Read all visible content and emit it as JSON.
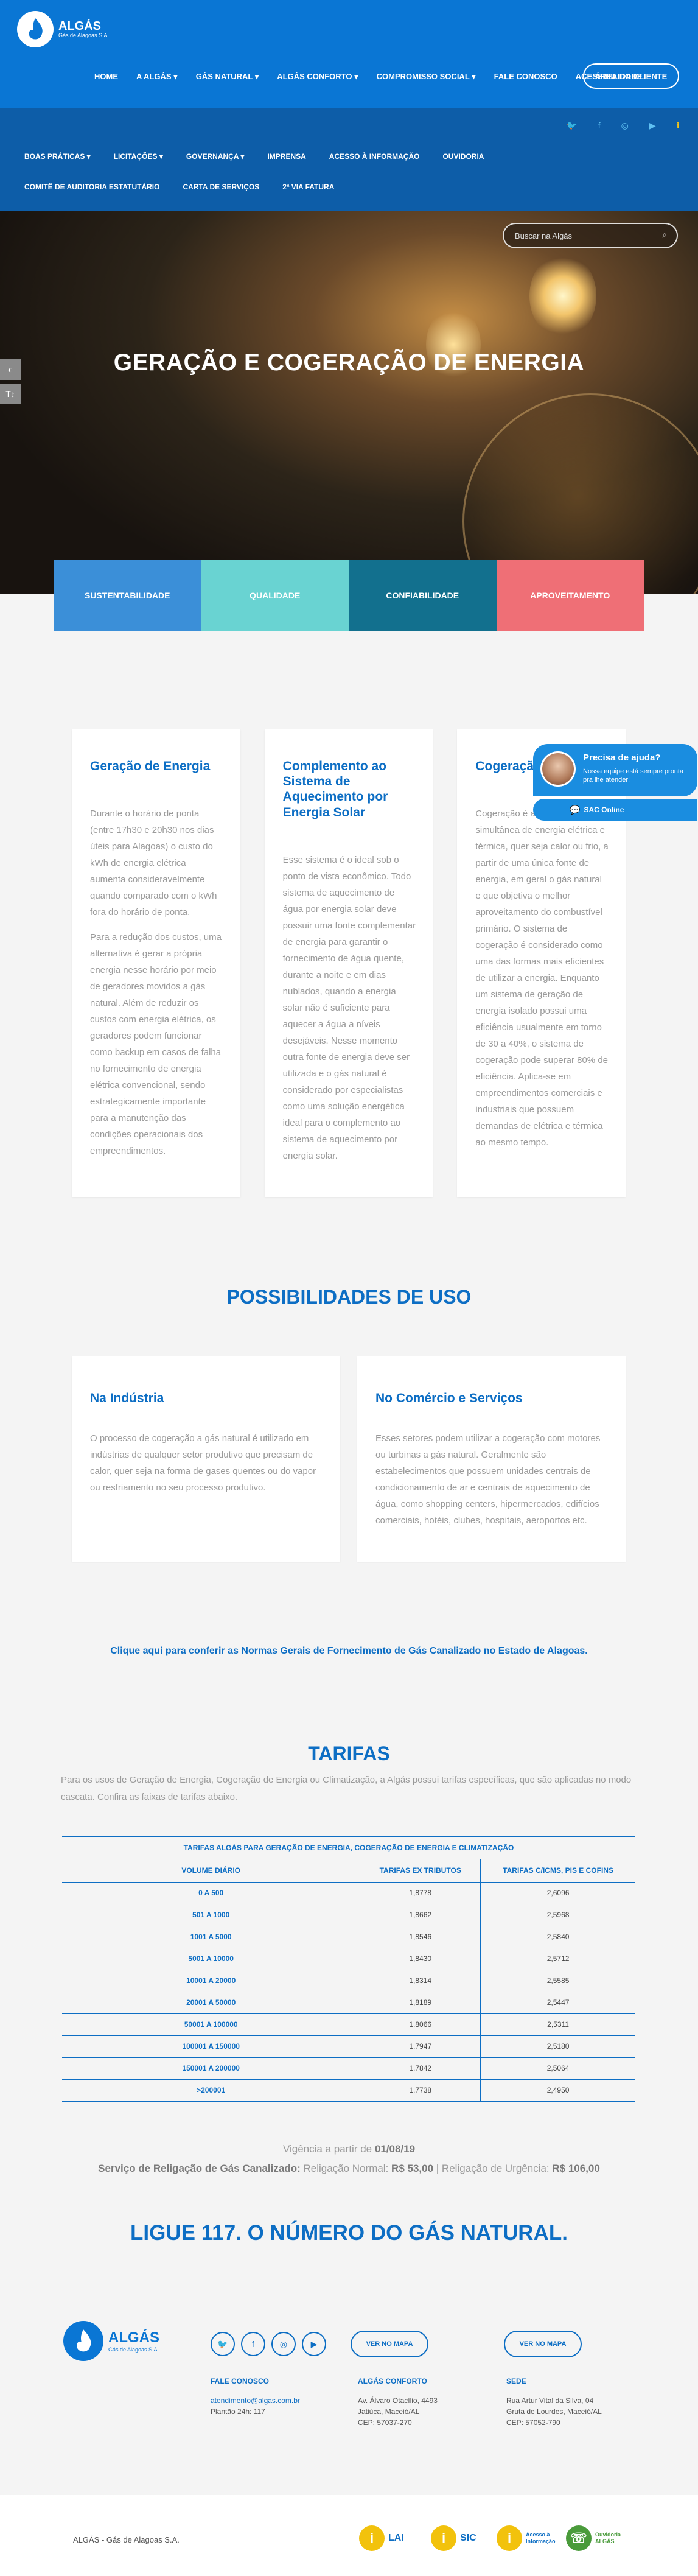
{
  "brand": {
    "name": "ALGÁS",
    "subtitle": "Gás de Alagoas S.A."
  },
  "main_nav": [
    "HOME",
    "A ALGÁS ▾",
    "GÁS NATURAL ▾",
    "ALGÁS CONFORTO ▾",
    "COMPROMISSO SOCIAL ▾",
    "FALE CONOSCO",
    "ACESSIBILIDADE"
  ],
  "client_area": "ÁREA DO CLIENTE",
  "sub_nav": [
    "BOAS PRÁTICAS ▾",
    "LICITAÇÕES ▾",
    "GOVERNANÇA ▾",
    "IMPRENSA",
    "ACESSO À INFORMAÇÃO",
    "OUVIDORIA",
    "COMITÊ DE AUDITORIA ESTATUTÁRIO",
    "CARTA DE SERVIÇOS",
    "2ª VIA FATURA"
  ],
  "search": {
    "placeholder": "Buscar na Algás"
  },
  "hero": {
    "title": "GERAÇÃO E COGERAÇÃO DE ENERGIA"
  },
  "pillars": [
    {
      "label": "SUSTENTABILIDADE",
      "color": "#3b8fd8"
    },
    {
      "label": "QUALIDADE",
      "color": "#69d3d2"
    },
    {
      "label": "CONFIABILIDADE",
      "color": "#12708e"
    },
    {
      "label": "APROVEITAMENTO",
      "color": "#ef6f76"
    }
  ],
  "cards": [
    {
      "title": "Geração de Energia",
      "paragraphs": [
        "Durante o horário de ponta (entre 17h30 e 20h30 nos dias úteis para Alagoas) o custo do kWh de energia elétrica aumenta consideravelmente quando comparado com o kWh fora do horário de ponta.",
        "Para a redução dos custos, uma alternativa é gerar a própria energia nesse horário por meio de geradores movidos a gás natural. Além de reduzir os custos com energia elétrica, os geradores podem funcionar como backup em casos de falha no fornecimento de energia elétrica convencional, sendo estrategicamente importante para a manutenção das condições operacionais dos empreendimentos."
      ]
    },
    {
      "title": "Complemento ao Sistema de Aquecimento por Energia Solar",
      "paragraphs": [
        "Esse sistema é o ideal sob o ponto de vista econômico. Todo sistema de aquecimento de água por energia solar deve possuir uma fonte complementar de energia para garantir o fornecimento de água quente, durante a noite e em dias nublados, quando a energia solar não é suficiente para aquecer a água a níveis desejáveis. Nesse momento outra fonte de energia deve ser utilizada e o gás natural é considerado por especialistas como uma solução energética ideal para o complemento ao sistema de aquecimento por energia solar."
      ]
    },
    {
      "title": "Cogeração",
      "paragraphs": [
        "Cogeração é a produção simultânea de energia elétrica e térmica, quer seja calor ou frio, a partir de uma única fonte de energia, em geral o gás natural e que objetiva o melhor aproveitamento do combustível primário. O sistema de cogeração é considerado como uma das formas mais eficientes de utilizar a energia. Enquanto um sistema de geração de energia isolado possui uma eficiência usualmente em torno de 30 a 40%, o sistema de cogeração pode superar 80% de eficiência. Aplica-se em empreendimentos comerciais e industriais que possuem demandas de elétrica e térmica ao mesmo tempo."
      ]
    }
  ],
  "uses": {
    "title": "POSSIBILIDADES DE USO",
    "items": [
      {
        "title": "Na Indústria",
        "text": "O processo de cogeração a gás natural é utilizado em indústrias de qualquer setor produtivo que precisam de calor, quer seja na forma de gases quentes ou do vapor ou resfriamento no seu processo produtivo."
      },
      {
        "title": "No Comércio e Serviços",
        "text": "Esses setores podem utilizar a cogeração com motores ou turbinas a gás natural. Geralmente são estabelecimentos que possuem unidades centrais de condicionamento de ar e centrais de aquecimento de água, como shopping centers, hipermercados, edifícios comerciais, hotéis, clubes, hospitais, aeroportos etc."
      }
    ]
  },
  "norms_link": "Clique aqui para conferir as Normas Gerais de Fornecimento de Gás Canalizado no Estado de Alagoas.",
  "tariffs": {
    "title": "TARIFAS",
    "intro": "Para os usos de Geração de Energia, Cogeração de Energia ou Climatização, a Algás possui tarifas específicas, que são aplicadas no modo cascata. Confira as faixas de tarifas abaixo.",
    "caption": "TARIFAS ALGÁS PARA GERAÇÃO DE ENERGIA, COGERAÇÃO DE ENERGIA E CLIMATIZAÇÃO",
    "headers": [
      "VOLUME DIÁRIO",
      "TARIFAS EX TRIBUTOS",
      "TARIFAS C/ICMS, PIS E COFINS"
    ],
    "rows": [
      [
        "0 A 500",
        "1,8778",
        "2,6096"
      ],
      [
        "501 A 1000",
        "1,8662",
        "2,5968"
      ],
      [
        "1001 A 5000",
        "1,8546",
        "2,5840"
      ],
      [
        "5001 A 10000",
        "1,8430",
        "2,5712"
      ],
      [
        "10001 A 20000",
        "1,8314",
        "2,5585"
      ],
      [
        "20001 A 50000",
        "1,8189",
        "2,5447"
      ],
      [
        "50001 A 100000",
        "1,8066",
        "2,5311"
      ],
      [
        "100001 A 150000",
        "1,7947",
        "2,5180"
      ],
      [
        "150001 A 200000",
        "1,7842",
        "2,5064"
      ],
      [
        ">200001",
        "1,7738",
        "2,4950"
      ]
    ],
    "validity_label": "Vigência a partir de",
    "validity_date": "01/08/19",
    "reconnection_label": "Serviço de Religação de Gás Canalizado:",
    "reconnection_normal_label": "Religação Normal:",
    "reconnection_normal": "R$ 53,00",
    "reconnection_urgent_label": "| Religação de Urgência:",
    "reconnection_urgent": "R$ 106,00"
  },
  "ligue": {
    "strong": "LIGUE 117.",
    "rest": " O NÚMERO DO GÁS NATURAL."
  },
  "footer": {
    "map_button": "VER NO MAPA",
    "contact": {
      "title": "FALE CONOSCO",
      "email": "atendimento@algas.com.br",
      "hours": "Plantão 24h: 117"
    },
    "conforto": {
      "title": "ALGÁS CONFORTO",
      "lines": [
        "Av. Álvaro Otacílio, 4493",
        "Jatiúca, Maceió/AL",
        "CEP: 57037-270"
      ]
    },
    "sede": {
      "title": "SEDE",
      "lines": [
        "Rua Artur Vital da Silva, 04",
        "Gruta de Lourdes, Maceió/AL",
        "CEP: 57052-790"
      ]
    },
    "copyright": "ALGÁS - Gás de Alagoas S.A.",
    "badges": [
      "LAI",
      "SIC",
      "Acesso à Informação",
      "Ouvidoria ALGÁS"
    ]
  },
  "chat": {
    "question": "Precisa de ajuda?",
    "subtitle": "Nossa equipe está sempre pronta pra lhe atender!",
    "sac": "SAC Online"
  },
  "icons": {
    "twitter": "twitter-icon",
    "facebook": "facebook-icon",
    "instagram": "instagram-icon",
    "youtube": "youtube-icon",
    "info": "info-icon"
  }
}
